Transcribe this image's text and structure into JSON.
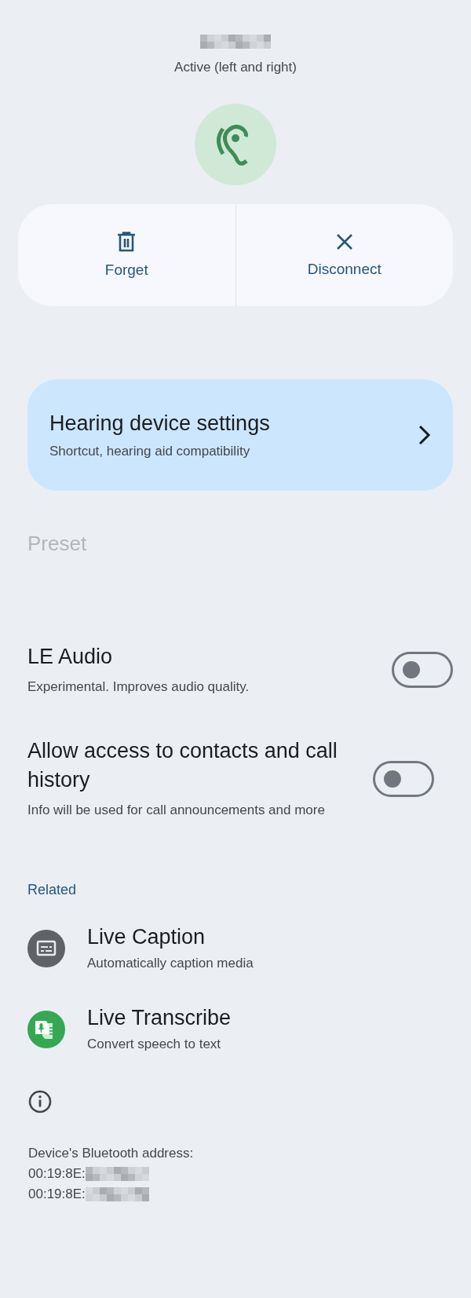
{
  "header": {
    "status": "Active (left and right)"
  },
  "actions": [
    {
      "kind": "delete",
      "label": "Forget"
    },
    {
      "kind": "close",
      "label": "Disconnect"
    }
  ],
  "settings_card": {
    "title": "Hearing device settings",
    "subtitle": "Shortcut, hearing aid compatibility"
  },
  "preset": {
    "title": "Preset",
    "disabled": true
  },
  "switches": [
    {
      "title": "LE Audio",
      "subtitle": "Experimental. Improves audio quality.",
      "on": false
    },
    {
      "title": "Allow access to contacts and call history",
      "subtitle": "Info will be used for call announcements and more",
      "on": false
    }
  ],
  "related": {
    "heading": "Related",
    "items": [
      {
        "kind": "caption",
        "title": "Live Caption",
        "subtitle": "Automatically caption media"
      },
      {
        "kind": "transcribe",
        "title": "Live Transcribe",
        "subtitle": "Convert speech to text"
      }
    ]
  },
  "footer": {
    "lines": [
      "Device's Bluetooth address:",
      "00:19:8E:",
      "00:19:8E:"
    ]
  }
}
